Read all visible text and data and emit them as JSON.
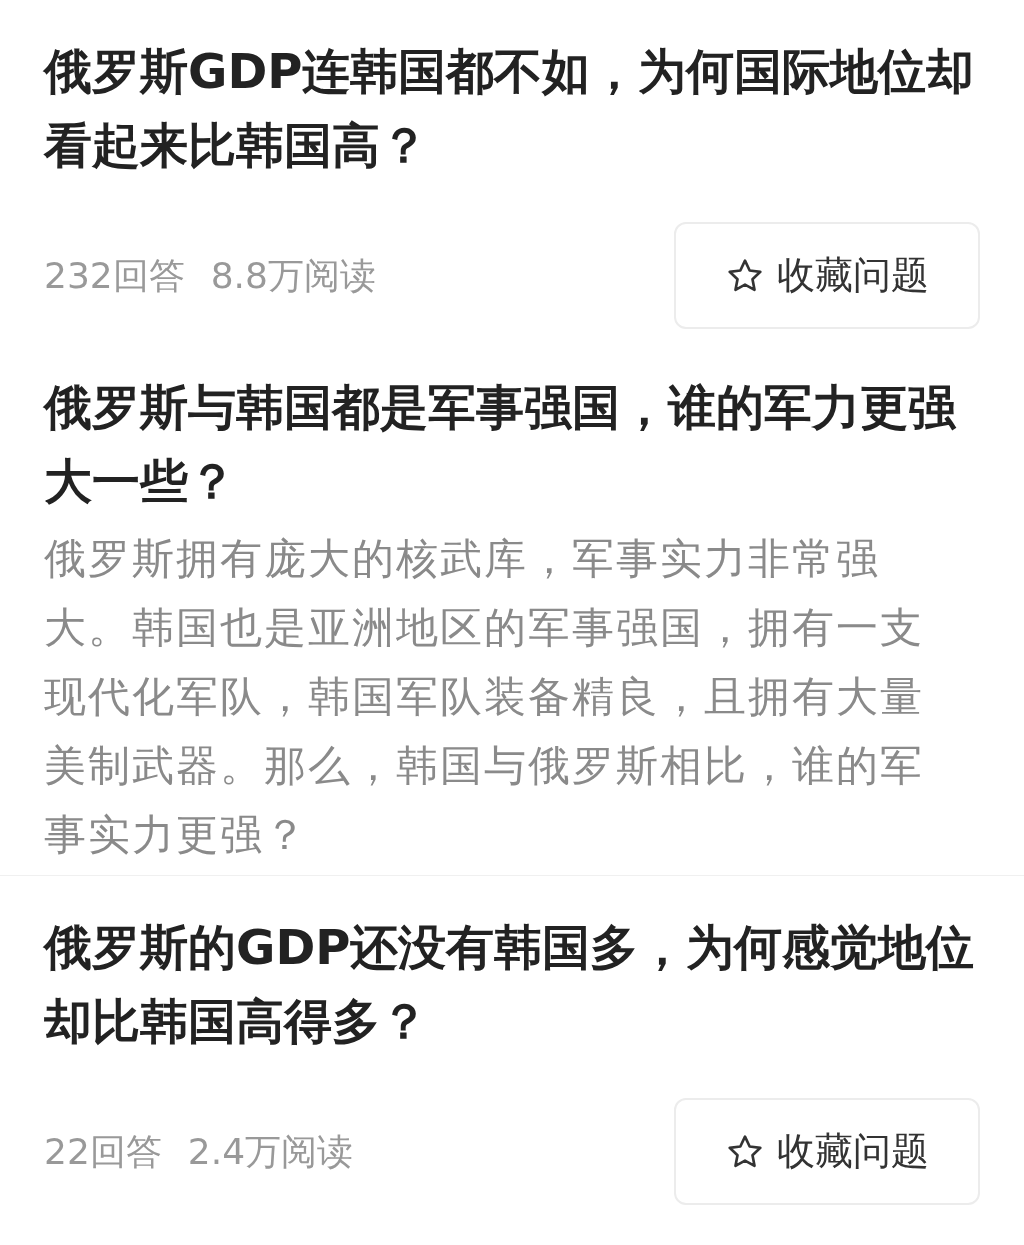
{
  "questions": [
    {
      "kind": "stats",
      "title": "俄罗斯GDP连韩国都不如，为何国际地位却看起来比韩国高？",
      "answers": "232回答",
      "reads": "8.8万阅读",
      "button": "收藏问题"
    },
    {
      "kind": "summary",
      "title": "俄罗斯与韩国都是军事强国，谁的军力更强大一些？",
      "description": "俄罗斯拥有庞大的核武库，军事实力非常强大。韩国也是亚洲地区的军事强国，拥有一支现代化军队，韩国军队装备精良，且拥有大量美制武器。那么，韩国与俄罗斯相比，谁的军事实力更强？"
    },
    {
      "kind": "stats",
      "title": "俄罗斯的GDP还没有韩国多，为何感觉地位却比韩国高得多？",
      "answers": "22回答",
      "reads": "2.4万阅读",
      "button": "收藏问题"
    }
  ]
}
